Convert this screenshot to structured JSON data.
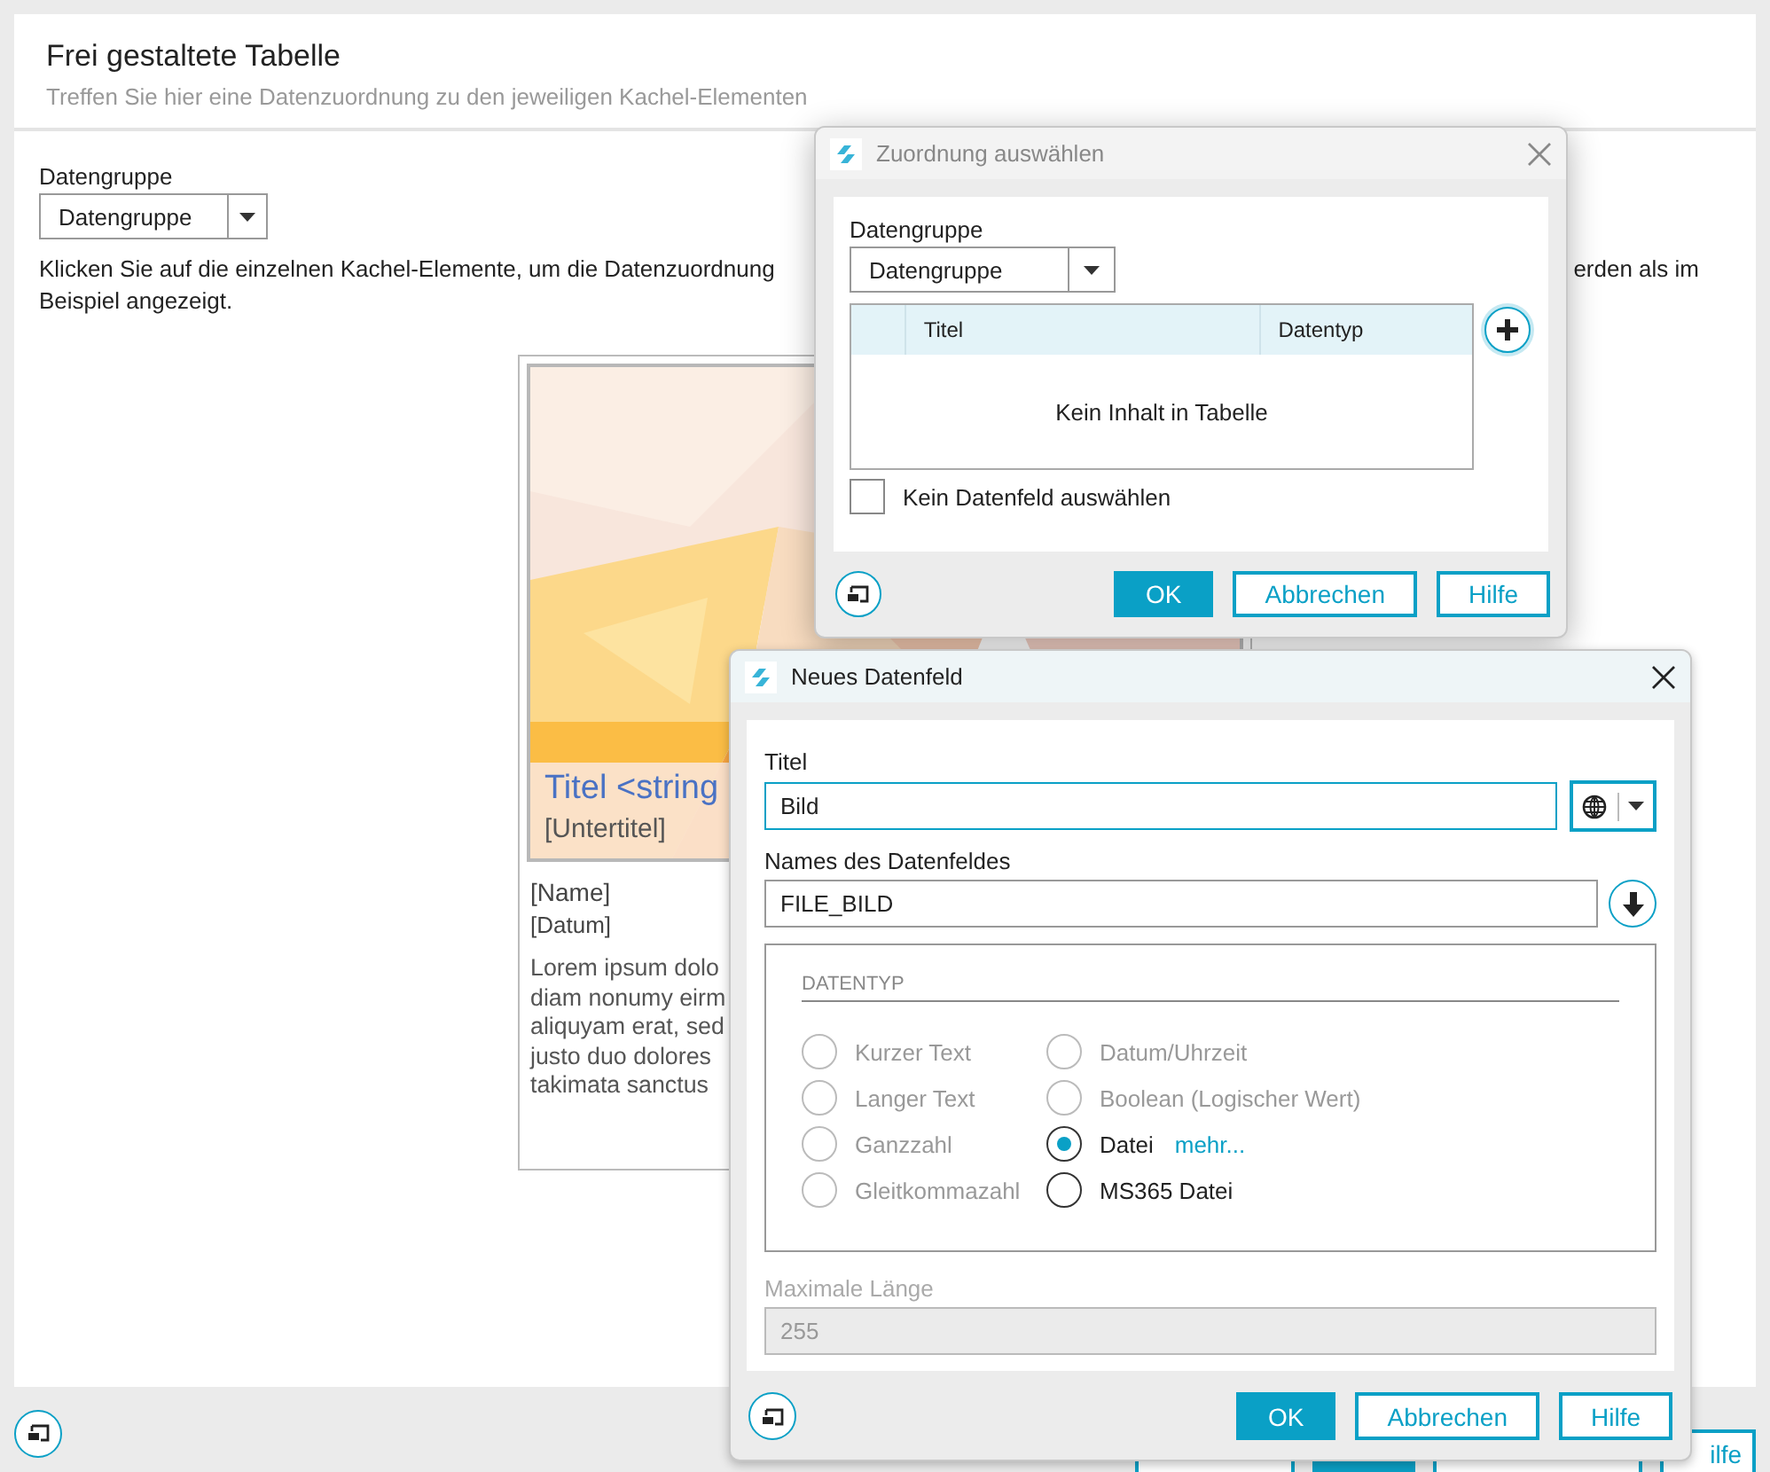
{
  "page": {
    "title": "Frei gestaltete Tabelle",
    "subtitle": "Treffen Sie hier eine Datenzuordnung zu den jeweiligen Kachel-Elementen",
    "data_group": {
      "label": "Datengruppe",
      "value": "Datengruppe"
    },
    "instruction": {
      "line_1": "Klicken Sie auf die einzelnen Kachel-Elemente, um die Datenzuordnung",
      "line_1_end": "erden als im",
      "line_2": "Beispiel angezeigt."
    },
    "tile": {
      "title": "Titel <string",
      "subtitle": "[Untertitel]",
      "name": "[Name]",
      "date": "[Datum]",
      "body_lines": [
        "Lorem ipsum dolo",
        "diam nonumy eirm",
        "aliquyam erat, sed",
        "justo duo dolores",
        "takimata sanctus"
      ]
    },
    "footer_buttons": [
      {
        "kind": "outline"
      },
      {
        "kind": "primary"
      },
      {
        "kind": "outline"
      },
      {
        "kind": "outline",
        "label": "ilfe"
      }
    ]
  },
  "mapping_dialog": {
    "title": "Zuordnung auswählen",
    "active": false,
    "data_group": {
      "label": "Datengruppe",
      "value": "Datengruppe"
    },
    "table": {
      "columns": [
        "Titel",
        "Datentyp"
      ],
      "empty_message": "Kein Inhalt in Tabelle"
    },
    "no_field_checkbox": {
      "label": "Kein Datenfeld auswählen",
      "checked": false
    },
    "buttons": [
      {
        "label": "OK",
        "kind": "primary"
      },
      {
        "label": "Abbrechen",
        "kind": "outline"
      },
      {
        "label": "Hilfe",
        "kind": "outline"
      }
    ]
  },
  "field_dialog": {
    "title": "Neues Datenfeld",
    "active": true,
    "title_field": {
      "label": "Titel",
      "value": "Bild",
      "focused": true
    },
    "name_field": {
      "label": "Names des Datenfeldes",
      "value": "FILE_BILD"
    },
    "data_type": {
      "heading": "DATENTYP",
      "options": [
        {
          "label": "Kurzer Text",
          "selected": false,
          "disabled": true
        },
        {
          "label": "Langer Text",
          "selected": false,
          "disabled": true
        },
        {
          "label": "Ganzzahl",
          "selected": false,
          "disabled": true
        },
        {
          "label": "Gleitkommazahl",
          "selected": false,
          "disabled": true
        },
        {
          "label": "Datum/Uhrzeit",
          "selected": false,
          "disabled": true
        },
        {
          "label": "Boolean (Logischer Wert)",
          "selected": false,
          "disabled": true
        },
        {
          "label": "Datei",
          "selected": true,
          "disabled": false,
          "link": "mehr..."
        },
        {
          "label": "MS365 Datei",
          "selected": false,
          "disabled": false
        }
      ]
    },
    "max_length": {
      "label": "Maximale Länge",
      "value": "255",
      "disabled": true
    },
    "buttons": [
      {
        "label": "OK",
        "kind": "primary"
      },
      {
        "label": "Abbrechen",
        "kind": "outline"
      },
      {
        "label": "Hilfe",
        "kind": "outline"
      }
    ]
  }
}
